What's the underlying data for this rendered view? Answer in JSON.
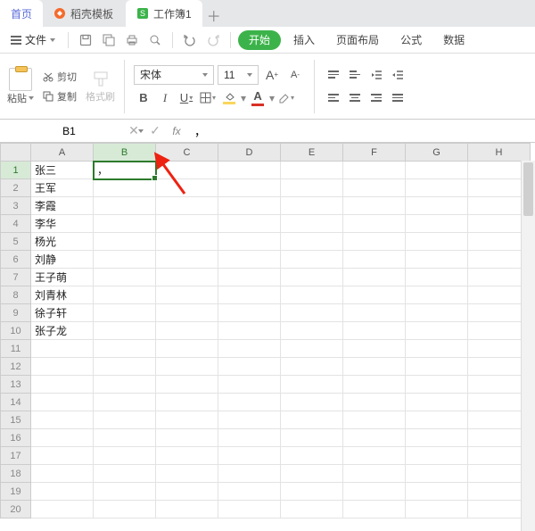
{
  "tabs": {
    "home": "首页",
    "template": "稻壳模板",
    "workbook": "工作簿1"
  },
  "menu": {
    "file": "文件",
    "start": "开始",
    "insert": "插入",
    "page_layout": "页面布局",
    "formulas": "公式",
    "data": "数据"
  },
  "ribbon": {
    "paste": "粘贴",
    "cut": "剪切",
    "copy": "复制",
    "format_painter": "格式刷",
    "font_name": "宋体",
    "font_size": "11"
  },
  "name_box": "B1",
  "formula_value": "，",
  "columns": [
    "A",
    "B",
    "C",
    "D",
    "E",
    "F",
    "G",
    "H"
  ],
  "selected_col_index": 1,
  "selected_row_index": 0,
  "rows": [
    {
      "n": 1,
      "A": "张三",
      "B": "，"
    },
    {
      "n": 2,
      "A": "王军"
    },
    {
      "n": 3,
      "A": "李霞"
    },
    {
      "n": 4,
      "A": "李华"
    },
    {
      "n": 5,
      "A": "杨光"
    },
    {
      "n": 6,
      "A": "刘静"
    },
    {
      "n": 7,
      "A": "王子萌"
    },
    {
      "n": 8,
      "A": "刘青林"
    },
    {
      "n": 9,
      "A": "徐子轩"
    },
    {
      "n": 10,
      "A": "张子龙"
    },
    {
      "n": 11
    },
    {
      "n": 12
    },
    {
      "n": 13
    },
    {
      "n": 14
    },
    {
      "n": 15
    },
    {
      "n": 16
    },
    {
      "n": 17
    },
    {
      "n": 18
    },
    {
      "n": 19
    },
    {
      "n": 20
    }
  ]
}
